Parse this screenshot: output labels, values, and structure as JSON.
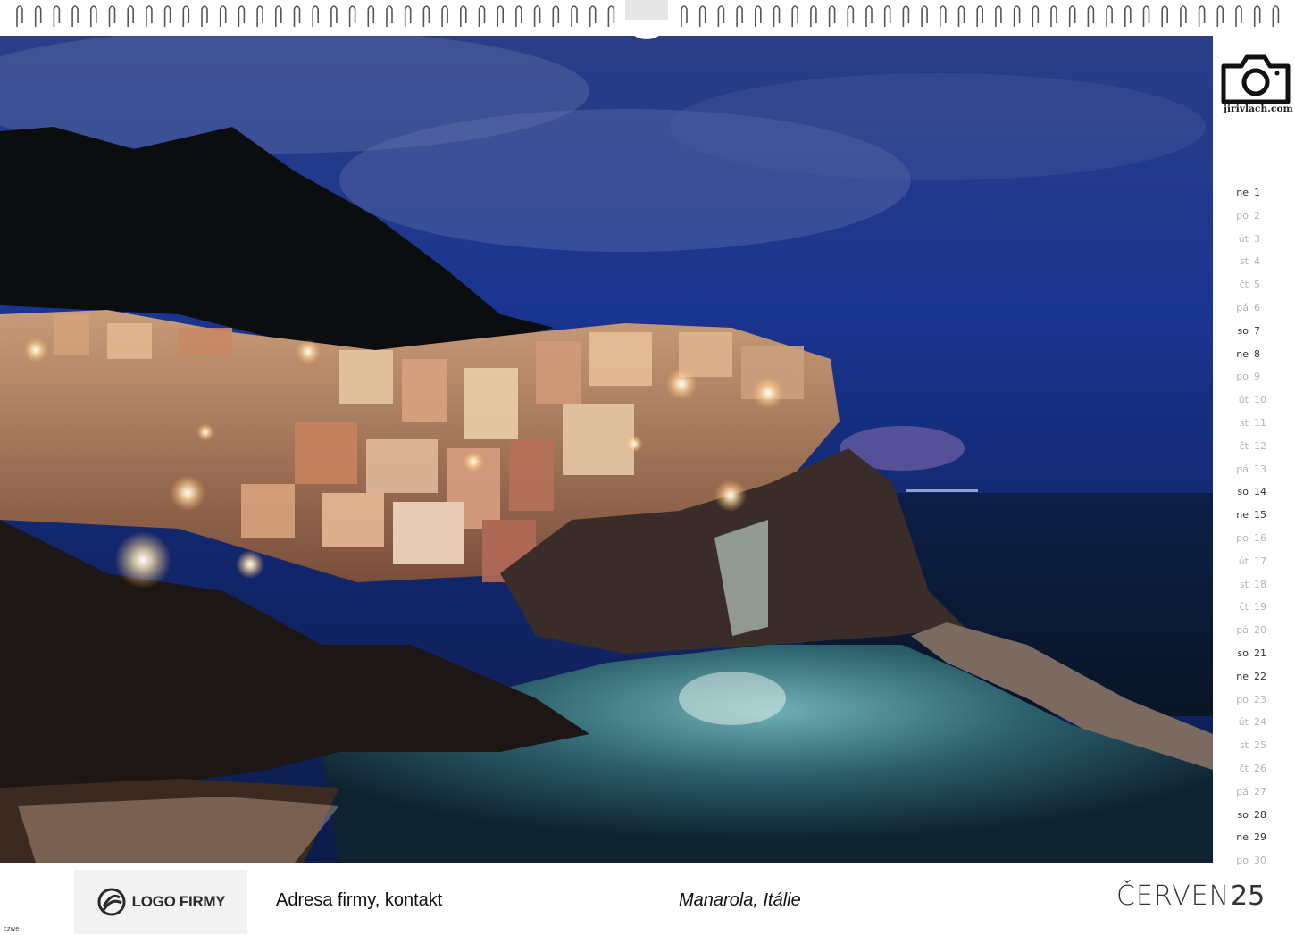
{
  "binding": {
    "label": "spiral-binding"
  },
  "photo": {
    "subject": "Manarola coastal village at night",
    "colors": {
      "sky": "#16307f",
      "sea": "#0d1c3a",
      "hill": "#0c1010"
    }
  },
  "brand": {
    "icon": "camera-icon",
    "text": "jirivlach.com"
  },
  "days": [
    {
      "wd": "ne",
      "d": "1",
      "weekend": true
    },
    {
      "wd": "po",
      "d": "2",
      "weekend": false
    },
    {
      "wd": "út",
      "d": "3",
      "weekend": false
    },
    {
      "wd": "st",
      "d": "4",
      "weekend": false
    },
    {
      "wd": "čt",
      "d": "5",
      "weekend": false
    },
    {
      "wd": "pá",
      "d": "6",
      "weekend": false
    },
    {
      "wd": "so",
      "d": "7",
      "weekend": true
    },
    {
      "wd": "ne",
      "d": "8",
      "weekend": true
    },
    {
      "wd": "po",
      "d": "9",
      "weekend": false
    },
    {
      "wd": "út",
      "d": "10",
      "weekend": false
    },
    {
      "wd": "st",
      "d": "11",
      "weekend": false
    },
    {
      "wd": "čt",
      "d": "12",
      "weekend": false
    },
    {
      "wd": "pá",
      "d": "13",
      "weekend": false
    },
    {
      "wd": "so",
      "d": "14",
      "weekend": true
    },
    {
      "wd": "ne",
      "d": "15",
      "weekend": true
    },
    {
      "wd": "po",
      "d": "16",
      "weekend": false
    },
    {
      "wd": "út",
      "d": "17",
      "weekend": false
    },
    {
      "wd": "st",
      "d": "18",
      "weekend": false
    },
    {
      "wd": "čt",
      "d": "19",
      "weekend": false
    },
    {
      "wd": "pá",
      "d": "20",
      "weekend": false
    },
    {
      "wd": "so",
      "d": "21",
      "weekend": true
    },
    {
      "wd": "ne",
      "d": "22",
      "weekend": true
    },
    {
      "wd": "po",
      "d": "23",
      "weekend": false
    },
    {
      "wd": "út",
      "d": "24",
      "weekend": false
    },
    {
      "wd": "st",
      "d": "25",
      "weekend": false
    },
    {
      "wd": "čt",
      "d": "26",
      "weekend": false
    },
    {
      "wd": "pá",
      "d": "27",
      "weekend": false
    },
    {
      "wd": "so",
      "d": "28",
      "weekend": true
    },
    {
      "wd": "ne",
      "d": "29",
      "weekend": true
    },
    {
      "wd": "po",
      "d": "30",
      "weekend": false
    }
  ],
  "footer": {
    "logo_text": "LOGO FIRMY",
    "logo_icon": "logo-mark-icon",
    "address": "Adresa firmy, kontakt",
    "caption": "Manarola, Itálie",
    "month": "ČERVEN",
    "year": "25",
    "tiny_mark": "czwe"
  },
  "colors": {
    "weekday": "#b5b5b5",
    "weekend": "#333333",
    "logo_bg": "#f2f2f2"
  }
}
